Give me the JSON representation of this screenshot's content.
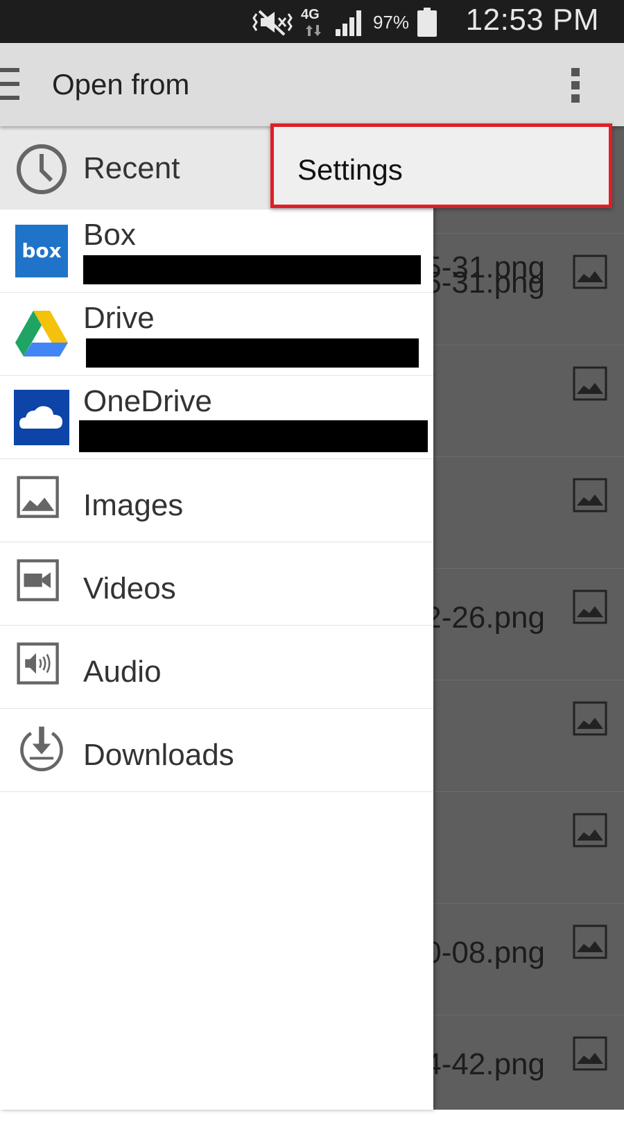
{
  "status_bar": {
    "battery": "97%",
    "time": "12:53 PM",
    "network": "4G"
  },
  "action_bar": {
    "title": "Open from"
  },
  "popup_menu": {
    "items": [
      {
        "label": "Settings"
      }
    ]
  },
  "drawer": {
    "items": [
      {
        "label": "Recent",
        "icon": "clock-icon"
      },
      {
        "label": "Box",
        "icon": "box-logo-icon"
      },
      {
        "label": "Drive",
        "icon": "google-drive-logo-icon"
      },
      {
        "label": "OneDrive",
        "icon": "onedrive-logo-icon"
      },
      {
        "label": "Images",
        "icon": "image-icon"
      },
      {
        "label": "Videos",
        "icon": "video-icon"
      },
      {
        "label": "Audio",
        "icon": "audio-icon"
      },
      {
        "label": "Downloads",
        "icon": "download-icon"
      }
    ]
  },
  "content": {
    "files": [
      "5-31.png",
      "",
      "",
      "2-26.png",
      "",
      "",
      "0-08.png",
      "4-42.png"
    ]
  },
  "colors": {
    "highlight": "#e01e26",
    "box_blue": "#1f73c9",
    "onedrive_blue": "#0c44a8"
  }
}
